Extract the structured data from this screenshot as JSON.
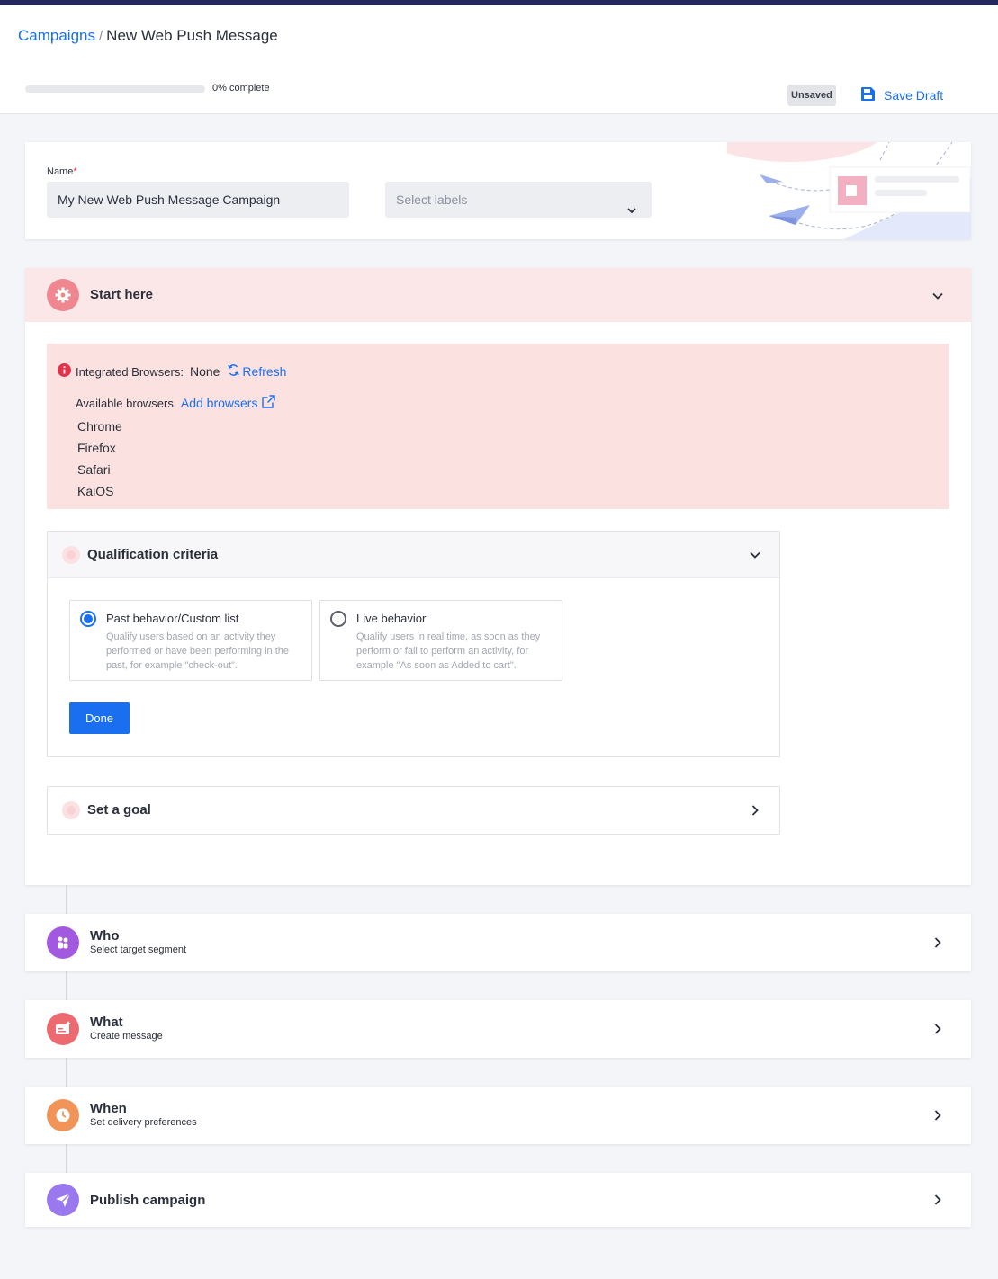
{
  "breadcrumb": {
    "parent": "Campaigns",
    "separator": "/",
    "current": "New Web Push Message"
  },
  "progress": {
    "percent": 0,
    "label": "0% complete"
  },
  "status_badge": "Unsaved",
  "save_draft_label": "Save Draft",
  "name_section": {
    "label": "Name",
    "required_mark": "*",
    "value": "My New Web Push Message Campaign",
    "labels_placeholder": "Select labels"
  },
  "start_here": {
    "title": "Start here",
    "integrated_label": "Integrated Browsers:",
    "integrated_value": "None",
    "refresh_label": "Refresh",
    "available_label": "Available browsers",
    "add_browsers_label": "Add browsers",
    "browsers": [
      "Chrome",
      "Firefox",
      "Safari",
      "KaiOS"
    ],
    "qualification": {
      "title": "Qualification criteria",
      "options": [
        {
          "title": "Past behavior/Custom list",
          "description": "Qualify users based on an activity they performed or have been performing in the past, for example \"check-out\".",
          "selected": true
        },
        {
          "title": "Live behavior",
          "description": "Qualify users in real time, as soon as they perform or fail to perform an activity, for example \"As soon as Added to cart\".",
          "selected": false
        }
      ],
      "done_label": "Done"
    },
    "goal_title": "Set a goal"
  },
  "steps": [
    {
      "title": "Who",
      "subtitle": "Select target segment",
      "color": "#a259e0"
    },
    {
      "title": "What",
      "subtitle": "Create message",
      "color": "#ec6b70"
    },
    {
      "title": "When",
      "subtitle": "Set delivery preferences",
      "color": "#f1945a"
    },
    {
      "title": "Publish campaign",
      "subtitle": "",
      "color": "#9a78ee"
    }
  ],
  "colors": {
    "accent": "#1a6ff0",
    "header_bar": "#24295e",
    "alert_bg": "#fbe1df",
    "start_bg": "#fbe7e8"
  }
}
